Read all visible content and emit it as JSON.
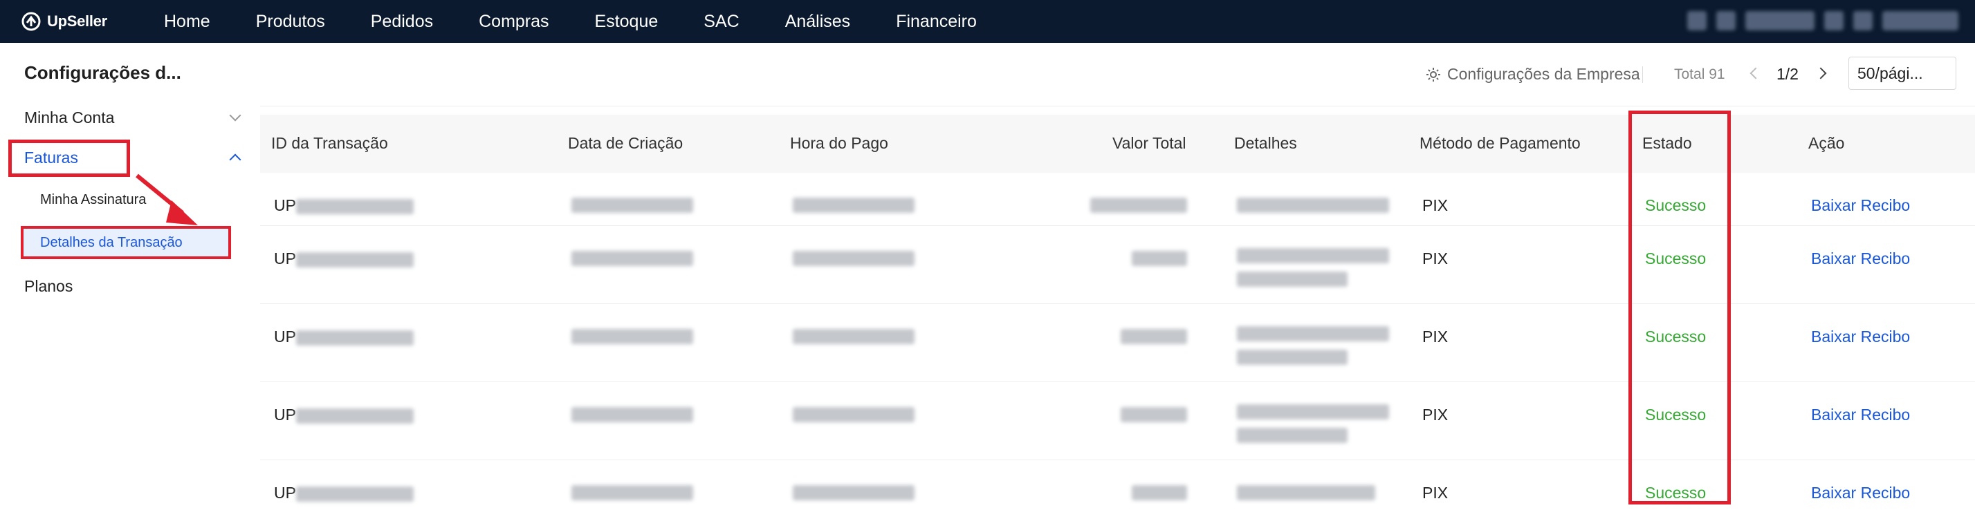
{
  "app": {
    "logo_text": "UpSeller",
    "nav": [
      "Home",
      "Produtos",
      "Pedidos",
      "Compras",
      "Estoque",
      "SAC",
      "Análises",
      "Financeiro"
    ]
  },
  "sidebar": {
    "title": "Configurações d...",
    "minha_conta": "Minha Conta",
    "faturas": "Faturas",
    "minha_assinatura": "Minha Assinatura",
    "detalhes_transacao": "Detalhes da Transação",
    "planos": "Planos"
  },
  "toolbar": {
    "company_settings": "Configurações da Empresa",
    "total": "Total 91",
    "page_indicator": "1/2",
    "page_size": "50/pági..."
  },
  "table": {
    "headers": [
      "ID da Transação",
      "Data de Criação",
      "Hora do Pago",
      "Valor Total",
      "Detalhes",
      "Método de Pagamento",
      "Estado",
      "Ação"
    ],
    "rows": [
      {
        "id_prefix": "UP",
        "method": "PIX",
        "status": "Sucesso",
        "action": "Baixar Recibo"
      },
      {
        "id_prefix": "UP",
        "method": "PIX",
        "status": "Sucesso",
        "action": "Baixar Recibo"
      },
      {
        "id_prefix": "UP",
        "method": "PIX",
        "status": "Sucesso",
        "action": "Baixar Recibo"
      },
      {
        "id_prefix": "UP",
        "method": "PIX",
        "status": "Sucesso",
        "action": "Baixar Recibo"
      },
      {
        "id_prefix": "UP",
        "method": "PIX",
        "status": "Sucesso",
        "action": "Baixar Recibo"
      }
    ]
  },
  "colors": {
    "topbar": "#0b1a2e",
    "accent": "#1a57d8",
    "success": "#34a832",
    "annotation": "#e0202e"
  }
}
